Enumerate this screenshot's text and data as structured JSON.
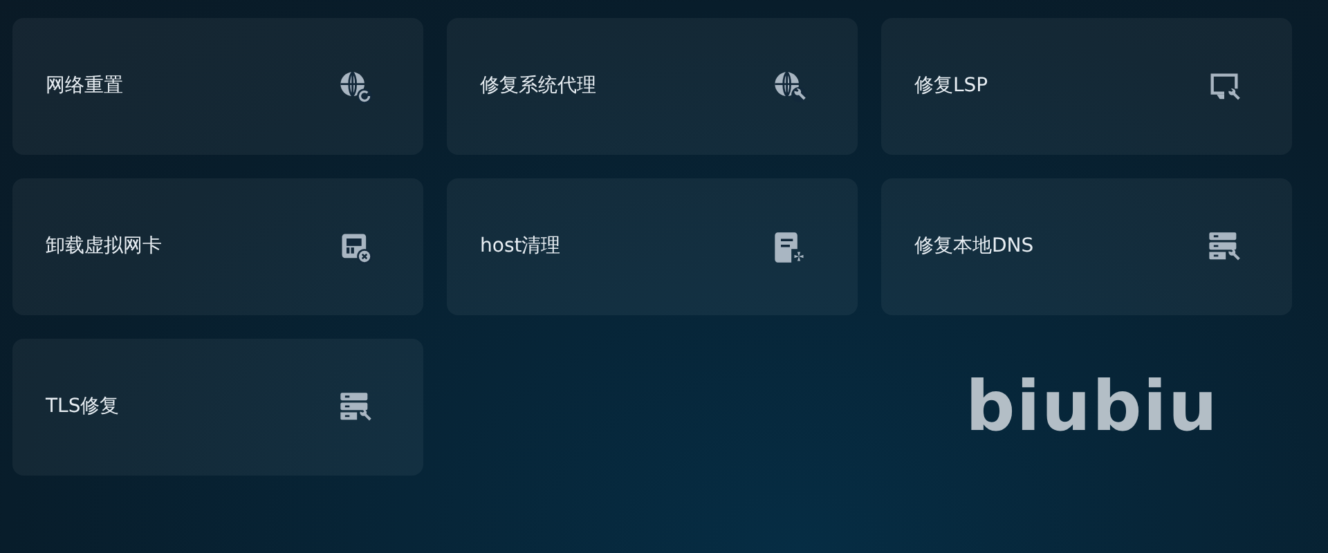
{
  "tools": [
    {
      "label": "网络重置"
    },
    {
      "label": "修复系统代理"
    },
    {
      "label": "修复LSP"
    },
    {
      "label": "卸载虚拟网卡"
    },
    {
      "label": "host清理"
    },
    {
      "label": "修复本地DNS"
    },
    {
      "label": "TLS修复"
    }
  ],
  "logo": "biubiu"
}
